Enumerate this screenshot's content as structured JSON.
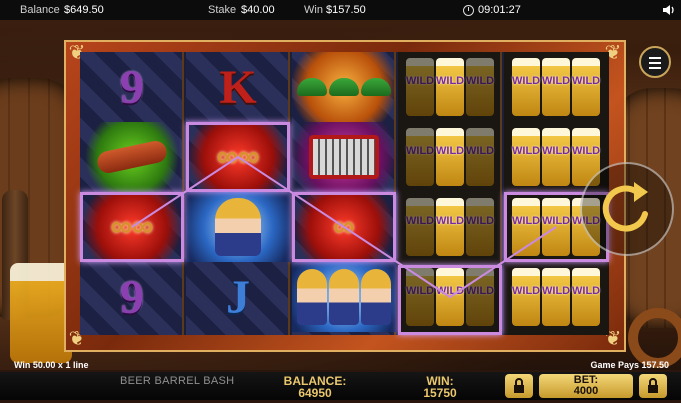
{
  "topbar": {
    "balance_label": "Balance",
    "balance_value": "$649.50",
    "stake_label": "Stake",
    "stake_value": "$40.00",
    "win_label": "Win",
    "win_value": "$157.50",
    "clock_icon": "clock-icon",
    "time": "09:01:27",
    "speaker_icon": "speaker-icon"
  },
  "reels": [
    {
      "symbols": [
        "9",
        "sausage",
        "pretzel",
        "9"
      ]
    },
    {
      "symbols": [
        "K",
        "pretzel",
        "girl",
        "J"
      ]
    },
    {
      "symbols": [
        "hats",
        "accordion",
        "pretzel",
        "girls"
      ]
    },
    {
      "symbols": [
        "WILD",
        "WILD",
        "WILD",
        "WILD"
      ]
    },
    {
      "symbols": [
        "WILD",
        "WILD",
        "WILD",
        "WILD"
      ]
    }
  ],
  "wild_label": "WILD",
  "winning_line": {
    "cells": [
      "reel1-row3",
      "reel2-row2",
      "reel3-row3",
      "reel4-row4",
      "reel5-row3"
    ],
    "color": "#c98ae0"
  },
  "buttons": {
    "menu_icon": "hamburger-menu-icon",
    "spin_icon": "spin-arrow-icon"
  },
  "winline": {
    "left_text": "Win 50.00 x 1 line",
    "right_text": "Game Pays 157.50"
  },
  "bottombar": {
    "game_name": "BEER BARREL BASH",
    "balance_label": "BALANCE:",
    "balance_value": "64950",
    "win_label": "WIN:",
    "win_value": "15750",
    "bet_label": "BET:",
    "bet_value": "4000",
    "lock_icon": "lock-icon"
  },
  "colors": {
    "gold": "#e9c76c",
    "frame": "#b8451b",
    "highlight": "#c98ae0"
  }
}
